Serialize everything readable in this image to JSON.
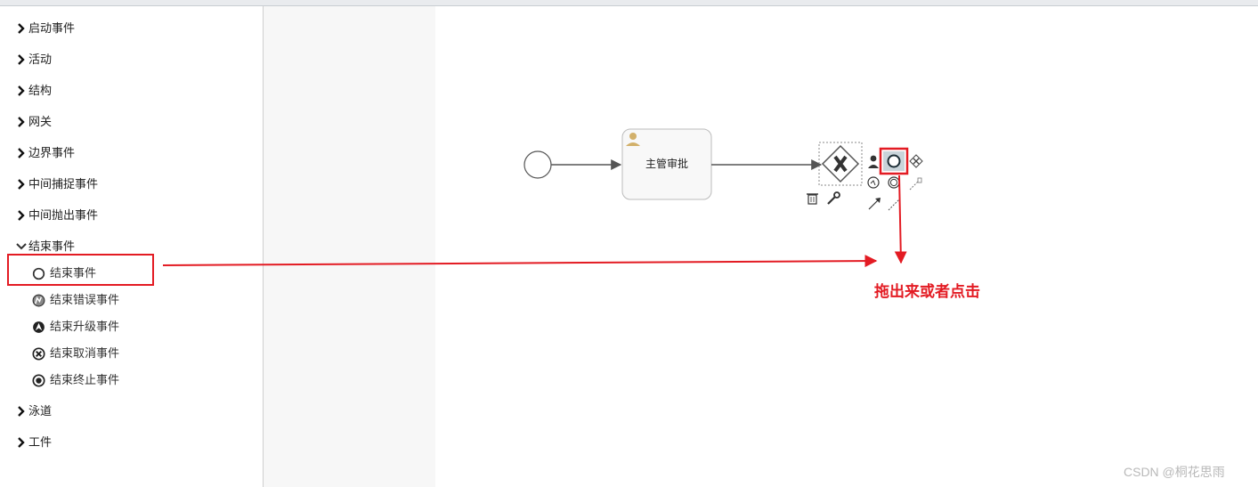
{
  "palette": {
    "categories": [
      {
        "label": "启动事件",
        "expanded": false
      },
      {
        "label": "活动",
        "expanded": false
      },
      {
        "label": "结构",
        "expanded": false
      },
      {
        "label": "网关",
        "expanded": false
      },
      {
        "label": "边界事件",
        "expanded": false
      },
      {
        "label": "中间捕捉事件",
        "expanded": false
      },
      {
        "label": "中间抛出事件",
        "expanded": false
      },
      {
        "label": "结束事件",
        "expanded": true
      },
      {
        "label": "泳道",
        "expanded": false
      },
      {
        "label": "工件",
        "expanded": false
      }
    ],
    "end_event_items": [
      {
        "label": "结束事件",
        "icon": "end-event-icon"
      },
      {
        "label": "结束错误事件",
        "icon": "end-error-event-icon"
      },
      {
        "label": "结束升级事件",
        "icon": "end-escalation-event-icon"
      },
      {
        "label": "结束取消事件",
        "icon": "end-cancel-event-icon"
      },
      {
        "label": "结束终止事件",
        "icon": "end-terminate-event-icon"
      }
    ]
  },
  "diagram": {
    "task_label": "主管审批",
    "gateway_type": "exclusive",
    "shortcut_icons": [
      "user-task-icon",
      "end-event-icon",
      "gateway-icon",
      "intermediate-event-icon",
      "event-ring-icon",
      "association-icon",
      "flow-arrow-icon",
      "dashed-line-icon",
      "delete-icon",
      "wrench-icon"
    ]
  },
  "annotation": {
    "text": "拖出来或者点击",
    "color": "#e31b23"
  },
  "watermark": "CSDN @桐花思雨"
}
